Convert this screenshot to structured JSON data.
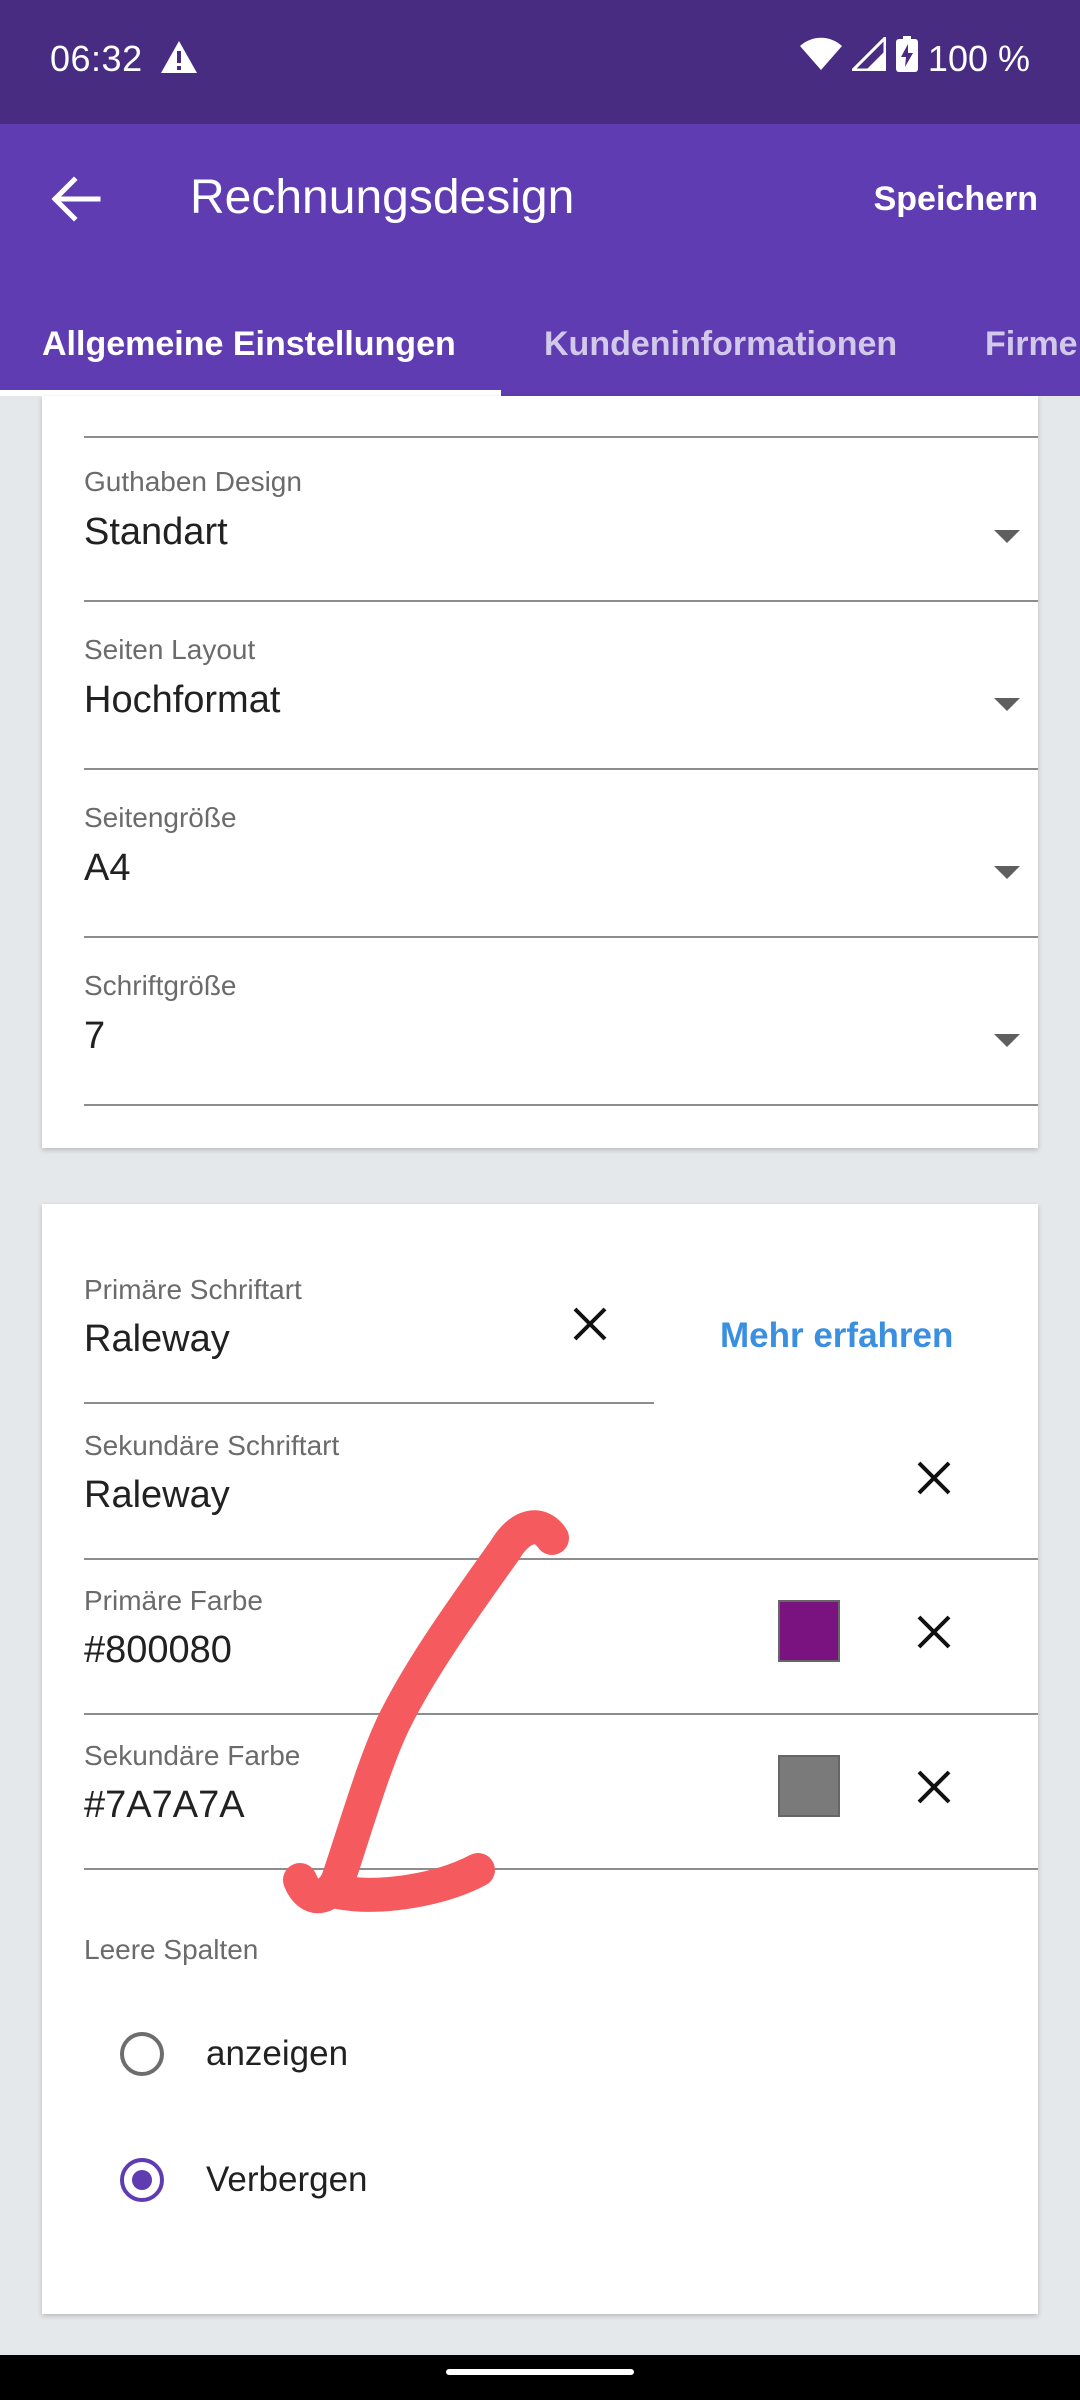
{
  "status_bar": {
    "time": "06:32",
    "battery": "100 %",
    "icons": [
      "warning-icon",
      "wifi-icon",
      "signal-icon",
      "battery-charging-icon"
    ]
  },
  "app_bar": {
    "title": "Rechnungsdesign",
    "save_label": "Speichern",
    "color": "#5f3cb2"
  },
  "tabs": [
    {
      "label": "Allgemeine Einstellungen",
      "active": true
    },
    {
      "label": "Kundeninformationen",
      "active": false
    },
    {
      "label": "Firme",
      "active": false
    }
  ],
  "page_settings": {
    "fields": [
      {
        "label": "Guthaben Design",
        "value": "Standart"
      },
      {
        "label": "Seiten Layout",
        "value": "Hochformat"
      },
      {
        "label": "Seitengröße",
        "value": "A4"
      },
      {
        "label": "Schriftgröße",
        "value": "7"
      }
    ]
  },
  "design_settings": {
    "primary_font": {
      "label": "Primäre Schriftart",
      "value": "Raleway"
    },
    "learn_more": "Mehr erfahren",
    "secondary_font": {
      "label": "Sekundäre Schriftart",
      "value": "Raleway"
    },
    "primary_color": {
      "label": "Primäre Farbe",
      "value": "#800080",
      "swatch": "#7a1380"
    },
    "secondary_color": {
      "label": "Sekundäre Farbe",
      "value": "#7A7A7A",
      "swatch": "#7a7a7a"
    },
    "empty_columns": {
      "label": "Leere Spalten",
      "options": [
        {
          "label": "anzeigen",
          "selected": false
        },
        {
          "label": "Verbergen",
          "selected": true
        }
      ]
    }
  },
  "annotation_color": "#f45a5e"
}
